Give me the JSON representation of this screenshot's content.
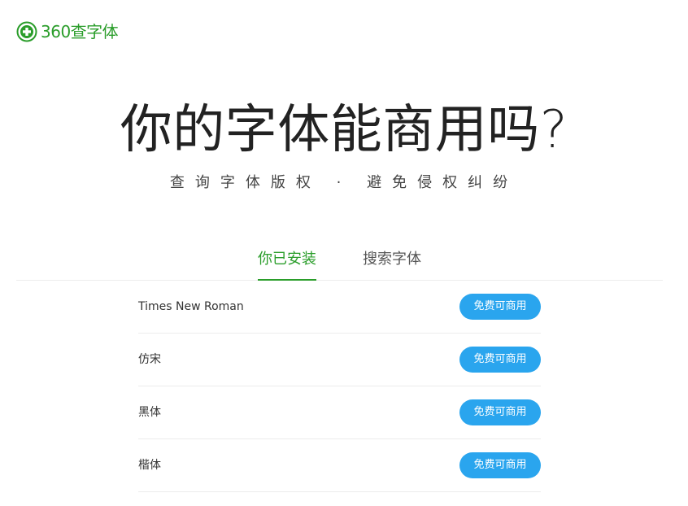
{
  "logo": {
    "text": "360查字体",
    "icon": "plus-circle-icon",
    "color": "#2a9d2a"
  },
  "hero": {
    "title": "你的字体能商用吗?",
    "subtitle": "查询字体版权 · 避免侵权纠纷"
  },
  "tabs": [
    {
      "label": "你已安装",
      "active": true
    },
    {
      "label": "搜索字体",
      "active": false
    }
  ],
  "fonts": [
    {
      "name": "Times New Roman",
      "status": "免费可商用"
    },
    {
      "name": "仿宋",
      "status": "免费可商用"
    },
    {
      "name": "黑体",
      "status": "免费可商用"
    },
    {
      "name": "楷体",
      "status": "免费可商用"
    }
  ],
  "colors": {
    "accent": "#2a9d2a",
    "badge": "#2aa5ee"
  }
}
